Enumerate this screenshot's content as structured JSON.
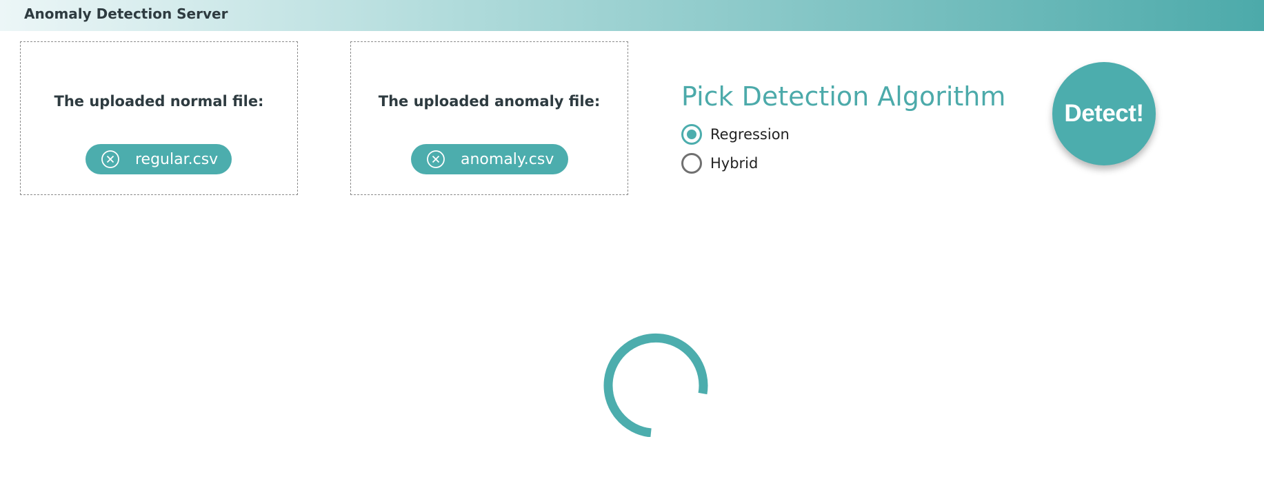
{
  "header": {
    "title": "Anomaly Detection Server"
  },
  "uploads": {
    "normal": {
      "label": "The uploaded normal file:",
      "file_name": "regular.csv"
    },
    "anomaly": {
      "label": "The uploaded anomaly file:",
      "file_name": "anomaly.csv"
    }
  },
  "algorithm": {
    "title": "Pick Detection Algorithm",
    "options": [
      {
        "label": "Regression",
        "checked": true
      },
      {
        "label": "Hybrid",
        "checked": false
      }
    ]
  },
  "detect_button": {
    "label": "Detect!"
  },
  "loading": {
    "icon": "spinner-icon"
  },
  "colors": {
    "accent": "#4cadad",
    "title_text": "#2e3b40"
  }
}
